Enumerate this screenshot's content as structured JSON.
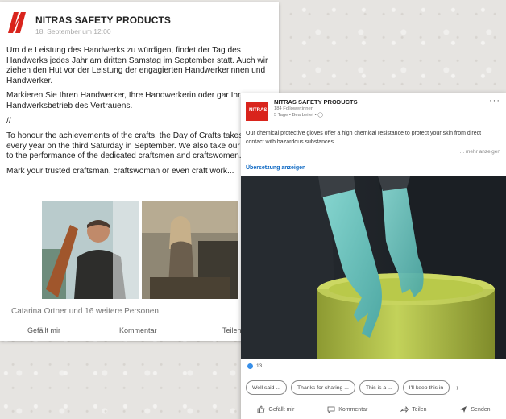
{
  "post1": {
    "company": "NITRAS SAFETY PRODUCTS",
    "timestamp": "18. September um 12:00",
    "paragraphs": [
      "Um die Leistung des Handwerks zu würdigen, findet der Tag des Handwerks jedes Jahr am dritten Samstag im September statt. Auch wir ziehen den Hut vor der Leistung der engagierten Handwerkerinnen und Handwerker.",
      "Markieren Sie Ihren Handwerker, Ihre Handwerkerin oder gar Ihren Handwerksbetrieb des Vertrauens.",
      "//",
      "To honour the achievements of the crafts, the Day of Crafts takes place every year on the third Saturday in September. We also take our hats off to the performance of the dedicated craftsmen and craftswomen.",
      "Mark your trusted craftsman, craftswoman or even craft work..."
    ],
    "reactions": "Catarina Ortner und 16 weitere Personen",
    "actions": {
      "like": "Gefällt mir",
      "comment": "Kommentar",
      "share": "Teilen"
    }
  },
  "post2": {
    "company": "NITRAS SAFETY PRODUCTS",
    "followers": "184 Follower:innen",
    "meta": "5 Tage • Bearbeitet • ",
    "logo_text": "NITRAS",
    "more": "···",
    "text": "Our chemical protective gloves offer a high chemical resistance to protect your skin from direct contact with hazardous substances.",
    "show_more": "... mehr anzeigen",
    "translation": "Übersetzung anzeigen",
    "like_count": "13",
    "chips": [
      "Well said ...",
      "Thanks for sharing ...",
      "This is a ...",
      "I'll keep this in"
    ],
    "chip_next": "›",
    "actions": {
      "like": "Gefällt mir",
      "comment": "Kommentar",
      "share": "Teilen",
      "send": "Senden"
    }
  },
  "colors": {
    "brand_red": "#d9241c",
    "link_blue": "#0a66c2",
    "glove_teal": "#6fc4bf",
    "barrel_green": "#b9c94a"
  }
}
